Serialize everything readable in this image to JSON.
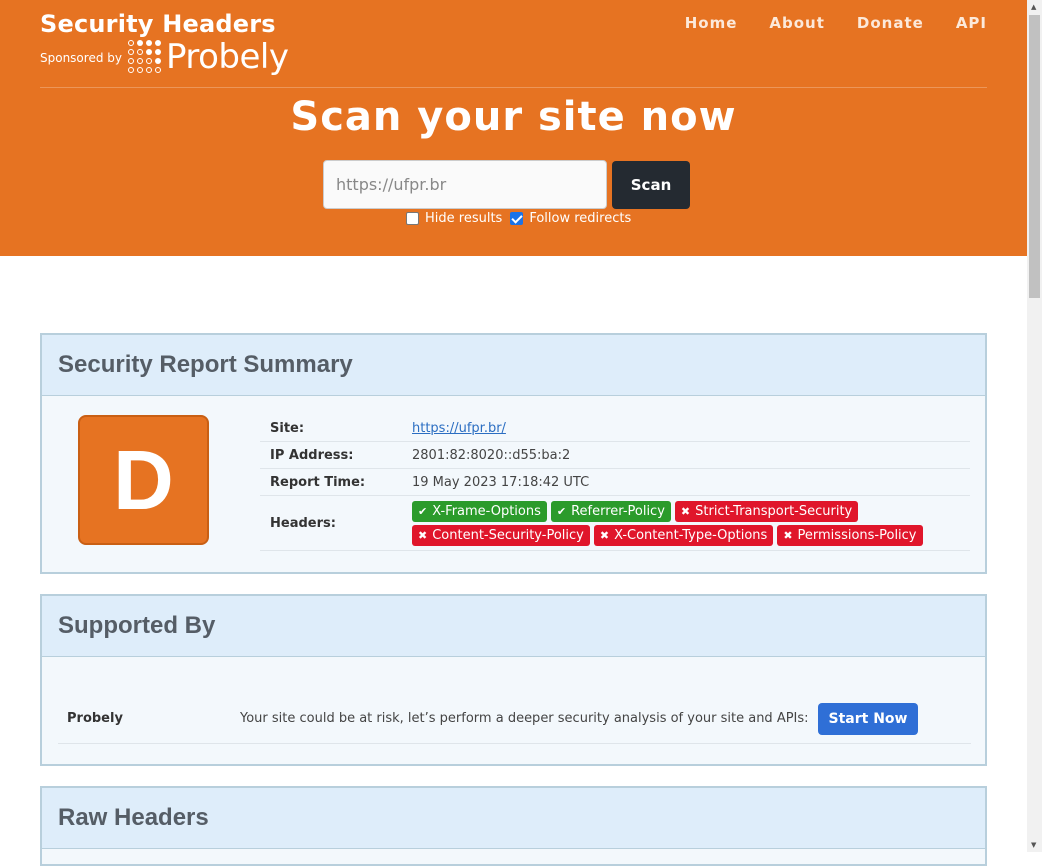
{
  "brand": {
    "title": "Security Headers",
    "sponsored_by": "Sponsored by",
    "sponsor_name": "Probely"
  },
  "nav": {
    "home": "Home",
    "about": "About",
    "donate": "Donate",
    "api": "API"
  },
  "scan": {
    "title": "Scan your site now",
    "input_value": "https://ufpr.br",
    "button": "Scan",
    "hide_results": "Hide results",
    "hide_results_checked": false,
    "follow_redirects": "Follow redirects",
    "follow_redirects_checked": true
  },
  "summary": {
    "heading": "Security Report Summary",
    "grade": "D",
    "site_label": "Site:",
    "site_value": "https://ufpr.br/",
    "ip_label": "IP Address:",
    "ip_value": "2801:82:8020::d55:ba:2",
    "time_label": "Report Time:",
    "time_value": "19 May 2023 17:18:42 UTC",
    "headers_label": "Headers:",
    "headers": [
      {
        "name": "X-Frame-Options",
        "status": "ok"
      },
      {
        "name": "Referrer-Policy",
        "status": "ok"
      },
      {
        "name": "Strict-Transport-Security",
        "status": "missing"
      },
      {
        "name": "Content-Security-Policy",
        "status": "missing"
      },
      {
        "name": "X-Content-Type-Options",
        "status": "missing"
      },
      {
        "name": "Permissions-Policy",
        "status": "missing"
      }
    ]
  },
  "supported": {
    "heading": "Supported By",
    "name": "Probely",
    "text": "Your site could be at risk, let’s perform a deeper security analysis of your site and APIs:",
    "button": "Start Now"
  },
  "raw": {
    "heading": "Raw Headers"
  },
  "colors": {
    "header_bg": "#e67322",
    "grade_bg": "#e67322",
    "ok_badge": "#2b9b2b",
    "bad_badge": "#e0162b",
    "start_button": "#2f6fd6"
  }
}
